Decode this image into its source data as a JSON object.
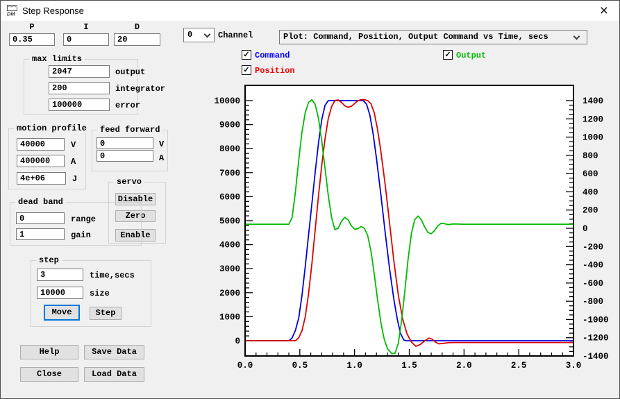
{
  "window": {
    "title": "Step Response",
    "icon_text": "DM",
    "close_glyph": "×"
  },
  "glyphs": {
    "check": "✓"
  },
  "pid": {
    "p_label": "P",
    "i_label": "I",
    "d_label": "D",
    "p": "0.35",
    "i": "0",
    "d": "20"
  },
  "max_limits": {
    "title": "max limits",
    "fields": [
      {
        "value": "2047",
        "label": "output"
      },
      {
        "value": "200",
        "label": "integrator"
      },
      {
        "value": "100000",
        "label": "error"
      }
    ]
  },
  "motion_profile": {
    "title": "motion profile",
    "fields": [
      {
        "value": "40000",
        "label": "V"
      },
      {
        "value": "400000",
        "label": "A"
      },
      {
        "value": "4e+06",
        "label": "J"
      }
    ]
  },
  "feed_forward": {
    "title": "feed forward",
    "fields": [
      {
        "value": "0",
        "label": "V"
      },
      {
        "value": "0",
        "label": "A"
      }
    ]
  },
  "servo": {
    "title": "servo",
    "buttons": [
      "Disable",
      "Zero",
      "Enable"
    ]
  },
  "dead_band": {
    "title": "dead band",
    "fields": [
      {
        "value": "0",
        "label": "range"
      },
      {
        "value": "1",
        "label": "gain"
      }
    ]
  },
  "step": {
    "title": "step",
    "fields": [
      {
        "value": "3",
        "label": "time,secs"
      },
      {
        "value": "10000",
        "label": "size"
      }
    ],
    "move_label": "Move",
    "step_label": "Step"
  },
  "footer": {
    "help": "Help",
    "save": "Save Data",
    "close": "Close",
    "load": "Load Data"
  },
  "channel": {
    "value": "0",
    "label": "Channel"
  },
  "plot_select": {
    "value": "Plot: Command, Position, Output Command vs Time, secs"
  },
  "legend": [
    {
      "label": "Command",
      "color": "#0000ff",
      "checked": true
    },
    {
      "label": "Position",
      "color": "#f00000",
      "checked": true
    },
    {
      "label": "Output",
      "color": "#00bb00",
      "checked": true
    }
  ],
  "chart_data": {
    "type": "line",
    "x_axis": {
      "min": 0,
      "max": 3,
      "major_step": 0.5,
      "minor_step": 0.1,
      "tick_labels": [
        "0.0",
        "0.5",
        "1.0",
        "1.5",
        "2.0",
        "2.5",
        "3.0"
      ]
    },
    "left_axis": {
      "min": 0,
      "max": 10000,
      "major_step": 1000,
      "minor_step": 200,
      "tick_labels": [
        "0",
        "1000",
        "2000",
        "3000",
        "4000",
        "5000",
        "6000",
        "7000",
        "8000",
        "9000",
        "10000"
      ]
    },
    "right_axis": {
      "min": -1400,
      "max": 1400,
      "major_step": 200,
      "minor_step": 50,
      "tick_labels": [
        "-1400",
        "-1200",
        "-1000",
        "-800",
        "-600",
        "-400",
        "-200",
        "0",
        "200",
        "400",
        "600",
        "800",
        "1000",
        "1200",
        "1400"
      ]
    },
    "series": [
      {
        "name": "Command",
        "axis": "left",
        "color": "#0000e0",
        "points": [
          [
            0,
            0
          ],
          [
            0.4,
            0
          ],
          [
            0.43,
            120
          ],
          [
            0.46,
            430
          ],
          [
            0.49,
            950
          ],
          [
            0.52,
            1900
          ],
          [
            0.55,
            3100
          ],
          [
            0.58,
            4400
          ],
          [
            0.61,
            5700
          ],
          [
            0.64,
            7000
          ],
          [
            0.67,
            8200
          ],
          [
            0.7,
            9200
          ],
          [
            0.73,
            9800
          ],
          [
            0.76,
            10000
          ],
          [
            1.08,
            10000
          ],
          [
            1.11,
            9850
          ],
          [
            1.14,
            9400
          ],
          [
            1.17,
            8600
          ],
          [
            1.2,
            7600
          ],
          [
            1.24,
            6100
          ],
          [
            1.28,
            4500
          ],
          [
            1.32,
            3000
          ],
          [
            1.36,
            1700
          ],
          [
            1.39,
            900
          ],
          [
            1.42,
            300
          ],
          [
            1.45,
            30
          ],
          [
            1.47,
            0
          ],
          [
            3.0,
            0
          ]
        ]
      },
      {
        "name": "Position",
        "axis": "left",
        "color": "#dd0000",
        "points": [
          [
            0,
            0
          ],
          [
            0.46,
            0
          ],
          [
            0.49,
            120
          ],
          [
            0.52,
            420
          ],
          [
            0.55,
            1000
          ],
          [
            0.58,
            1950
          ],
          [
            0.61,
            3200
          ],
          [
            0.64,
            4600
          ],
          [
            0.67,
            6000
          ],
          [
            0.7,
            7300
          ],
          [
            0.73,
            8400
          ],
          [
            0.76,
            9250
          ],
          [
            0.79,
            9750
          ],
          [
            0.82,
            10000
          ],
          [
            0.85,
            10030
          ],
          [
            0.88,
            9930
          ],
          [
            0.91,
            9790
          ],
          [
            0.94,
            9720
          ],
          [
            0.97,
            9760
          ],
          [
            1.0,
            9880
          ],
          [
            1.03,
            9990
          ],
          [
            1.06,
            10040
          ],
          [
            1.09,
            10040
          ],
          [
            1.12,
            10000
          ],
          [
            1.15,
            9870
          ],
          [
            1.18,
            9500
          ],
          [
            1.21,
            8800
          ],
          [
            1.24,
            7900
          ],
          [
            1.28,
            6500
          ],
          [
            1.32,
            4900
          ],
          [
            1.36,
            3300
          ],
          [
            1.4,
            1900
          ],
          [
            1.44,
            900
          ],
          [
            1.48,
            280
          ],
          [
            1.52,
            -60
          ],
          [
            1.56,
            -230
          ],
          [
            1.6,
            -160
          ],
          [
            1.64,
            -10
          ],
          [
            1.68,
            110
          ],
          [
            1.71,
            60
          ],
          [
            1.74,
            -60
          ],
          [
            1.77,
            -130
          ],
          [
            1.81,
            -110
          ],
          [
            1.86,
            -80
          ],
          [
            1.92,
            -75
          ],
          [
            3.0,
            -75
          ]
        ]
      },
      {
        "name": "Output",
        "axis": "right",
        "color": "#00bb00",
        "points": [
          [
            0,
            45
          ],
          [
            0.4,
            45
          ],
          [
            0.43,
            120
          ],
          [
            0.46,
            400
          ],
          [
            0.49,
            750
          ],
          [
            0.52,
            1060
          ],
          [
            0.55,
            1270
          ],
          [
            0.58,
            1380
          ],
          [
            0.61,
            1410
          ],
          [
            0.64,
            1360
          ],
          [
            0.67,
            1210
          ],
          [
            0.7,
            960
          ],
          [
            0.73,
            660
          ],
          [
            0.76,
            360
          ],
          [
            0.79,
            120
          ],
          [
            0.82,
            -15
          ],
          [
            0.85,
            0
          ],
          [
            0.88,
            75
          ],
          [
            0.91,
            120
          ],
          [
            0.94,
            95
          ],
          [
            0.97,
            30
          ],
          [
            1.0,
            -10
          ],
          [
            1.03,
            -5
          ],
          [
            1.06,
            20
          ],
          [
            1.09,
            0
          ],
          [
            1.12,
            -80
          ],
          [
            1.15,
            -250
          ],
          [
            1.18,
            -500
          ],
          [
            1.21,
            -780
          ],
          [
            1.24,
            -1030
          ],
          [
            1.27,
            -1210
          ],
          [
            1.3,
            -1320
          ],
          [
            1.34,
            -1375
          ],
          [
            1.37,
            -1370
          ],
          [
            1.4,
            -1260
          ],
          [
            1.43,
            -1010
          ],
          [
            1.46,
            -680
          ],
          [
            1.49,
            -330
          ],
          [
            1.52,
            -50
          ],
          [
            1.55,
            95
          ],
          [
            1.58,
            135
          ],
          [
            1.61,
            95
          ],
          [
            1.64,
            15
          ],
          [
            1.67,
            -45
          ],
          [
            1.7,
            -60
          ],
          [
            1.73,
            -25
          ],
          [
            1.76,
            25
          ],
          [
            1.79,
            55
          ],
          [
            1.82,
            50
          ],
          [
            1.86,
            40
          ],
          [
            1.9,
            48
          ],
          [
            2.0,
            45
          ],
          [
            3.0,
            45
          ]
        ]
      }
    ]
  }
}
